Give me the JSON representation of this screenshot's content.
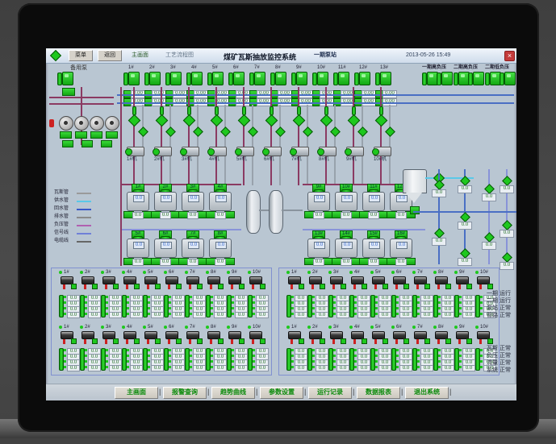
{
  "window": {
    "btn1": "菜单",
    "btn2": "返回",
    "text1": "主画面",
    "text2": "工艺流程图",
    "title": "煤矿瓦斯抽放监控系统",
    "subtitle": "一期泵站",
    "datetime": "2013-05-26 15:49",
    "close": "×"
  },
  "top": {
    "left_label": "备用泵",
    "pump_labels": [
      "1#",
      "2#",
      "3#",
      "4#",
      "5#",
      "6#",
      "7#",
      "8#",
      "9#",
      "10#",
      "11#",
      "12#",
      "13#"
    ],
    "right_headers": [
      "一期高负压",
      "二期高负压",
      "二期低负压"
    ],
    "strip_value": "0.00"
  },
  "valves": {
    "pump_labels": [
      "1#机",
      "2#机",
      "3#机",
      "4#机",
      "5#机",
      "6#机",
      "7#机",
      "8#机",
      "9#机",
      "10#机"
    ]
  },
  "legend": {
    "items": [
      {
        "label": "瓦斯管",
        "color": "#9a9a9a"
      },
      {
        "label": "供水管",
        "color": "#5ac8e8"
      },
      {
        "label": "回水管",
        "color": "#3858c8"
      },
      {
        "label": "排水管",
        "color": "#8a8a8a"
      },
      {
        "label": "负压管",
        "color": "#b060b0"
      },
      {
        "label": "信号线",
        "color": "#7080d8"
      },
      {
        "label": "电缆线",
        "color": "#666666"
      }
    ]
  },
  "skids": {
    "group_a_top": [
      "1#",
      "2#",
      "3#",
      "4#"
    ],
    "group_a_bottom": [
      "5#",
      "6#",
      "7#",
      "8#"
    ],
    "group_b_top": [
      "9#",
      "10#",
      "11#",
      "12#"
    ],
    "group_b_bottom": [
      "13#",
      "14#",
      "15#",
      "16#"
    ],
    "display": "0.0"
  },
  "pipes": {
    "device_value": "0.0"
  },
  "panels": {
    "cols": [
      "1#",
      "2#",
      "3#",
      "4#",
      "5#",
      "6#",
      "7#",
      "8#",
      "9#",
      "10#"
    ],
    "readout_value": "0.0"
  },
  "notes": {
    "block1": [
      "一期 运行",
      "二期 运行",
      "泵站 正常",
      "管路 正常"
    ],
    "block2": [
      "瓦斯 正常",
      "负压 正常",
      "流量 正常",
      "系统 正常"
    ]
  },
  "buttons": [
    "主画面",
    "报警查询",
    "趋势曲线",
    "参数设置",
    "运行记录",
    "数据报表",
    "退出系统"
  ],
  "colors": {
    "green": "#1ec81e",
    "maroon": "#8b3a62",
    "blue": "#4a6fc4",
    "periwinkle": "#8893d8",
    "cyan": "#5ac8e8",
    "panel_border": "#8090d0",
    "red": "#cc2222"
  }
}
